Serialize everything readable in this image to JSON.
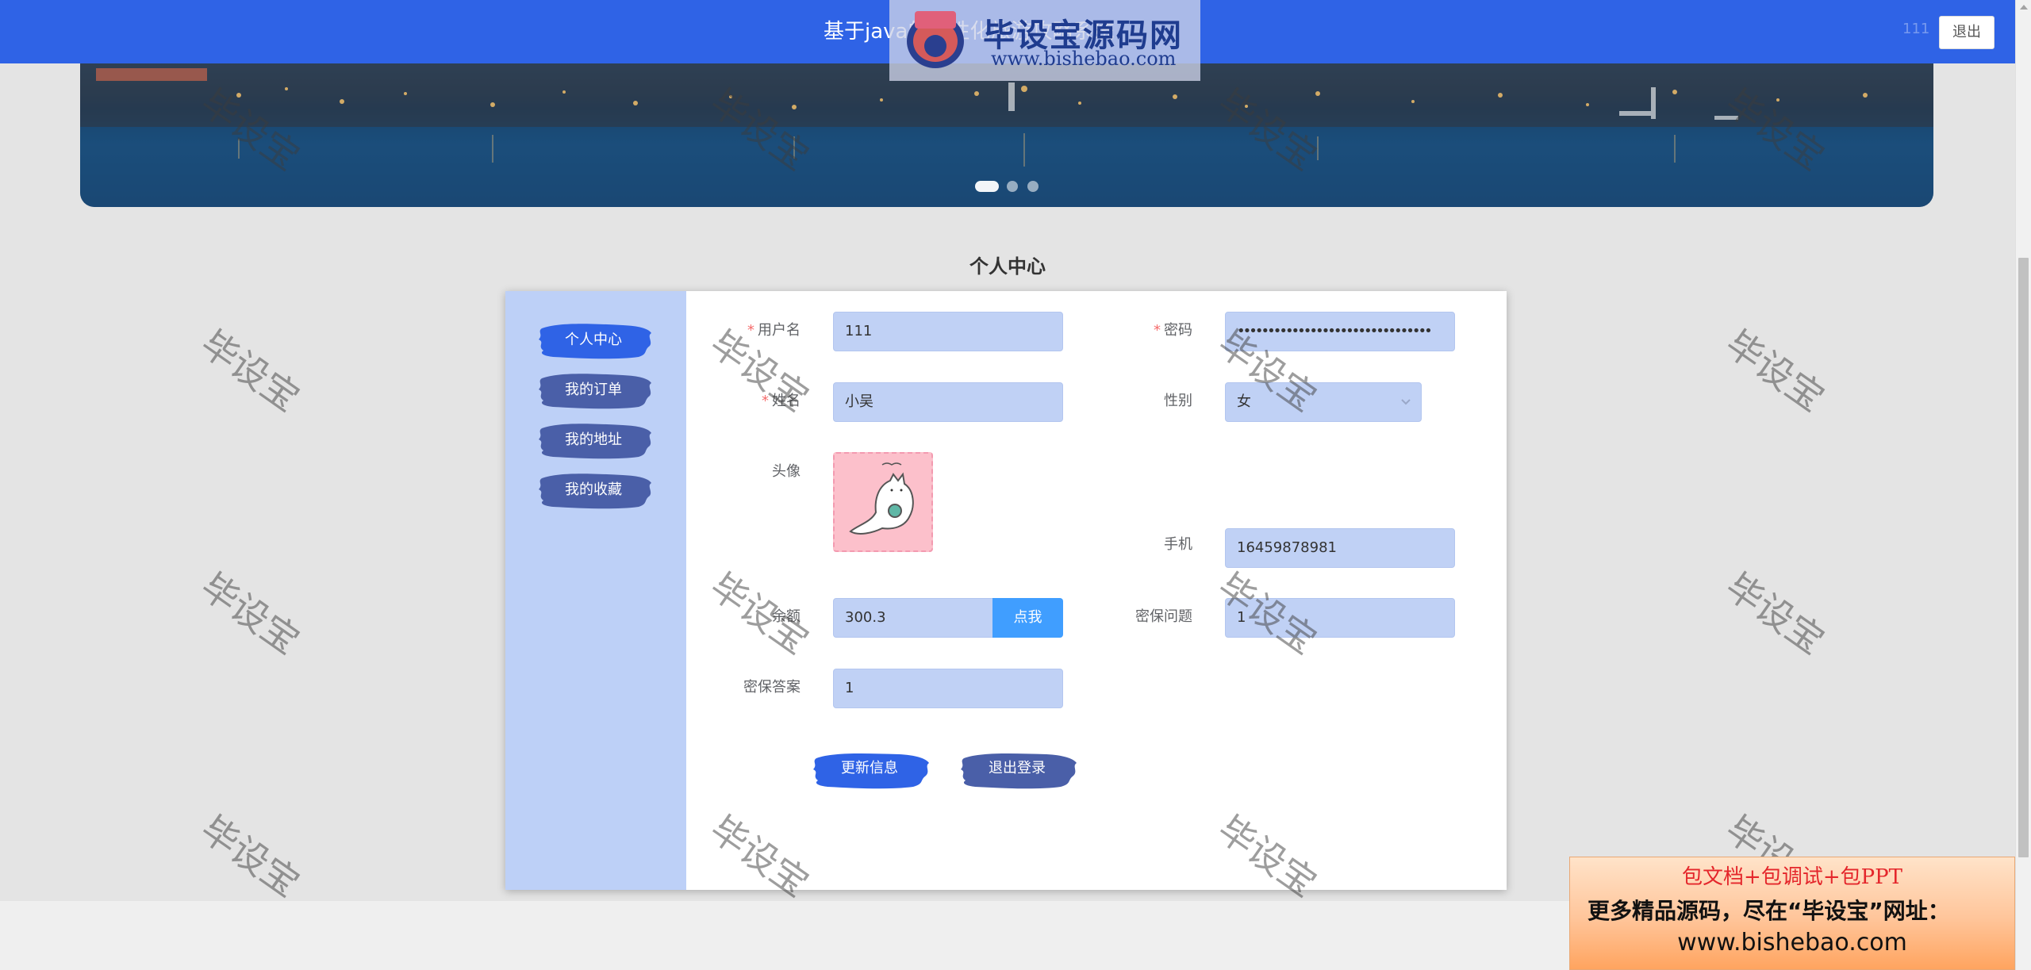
{
  "nav": {
    "title": "基于java的个性化旅游攻略系统",
    "user_label": "111",
    "logout_label": "退出"
  },
  "logo": {
    "name": "毕设宝源码网",
    "url": "www.bishebao.com"
  },
  "banner": {
    "slide_count": 3,
    "active_slide": 1
  },
  "section_title": "个人中心",
  "sidebar": {
    "items": [
      {
        "label": "个人中心",
        "active": true
      },
      {
        "label": "我的订单",
        "active": false
      },
      {
        "label": "我的地址",
        "active": false
      },
      {
        "label": "我的收藏",
        "active": false
      }
    ]
  },
  "form": {
    "username": {
      "label": "用户名",
      "required": true,
      "value": "111"
    },
    "password": {
      "label": "密码",
      "required": true,
      "value": "••••••••••••••••••••••••••••••••"
    },
    "name": {
      "label": "姓名",
      "required": true,
      "value": "小吴"
    },
    "gender": {
      "label": "性别",
      "value": "女"
    },
    "avatar": {
      "label": "头像"
    },
    "phone": {
      "label": "手机",
      "value": "16459878981"
    },
    "balance": {
      "label": "余额",
      "value": "300.3",
      "button": "点我"
    },
    "security_question": {
      "label": "密保问题",
      "value": "1"
    },
    "security_answer": {
      "label": "密保答案",
      "value": "1"
    }
  },
  "actions": {
    "update_label": "更新信息",
    "logout_label": "退出登录"
  },
  "watermark_text": "毕设宝",
  "ad": {
    "line1": "包文档+包调试+包PPT",
    "line2": "更多精品源码，尽在“毕设宝”网址：",
    "line3": "www.bishebao.com"
  },
  "colors": {
    "nav_bg": "#2f63e6",
    "sidebar_bg": "#bdd0f7",
    "input_bg": "#c0d1f5",
    "brush_active": "#2f63e6",
    "brush_inactive": "#4a5fa8",
    "pay_button": "#409eff"
  }
}
